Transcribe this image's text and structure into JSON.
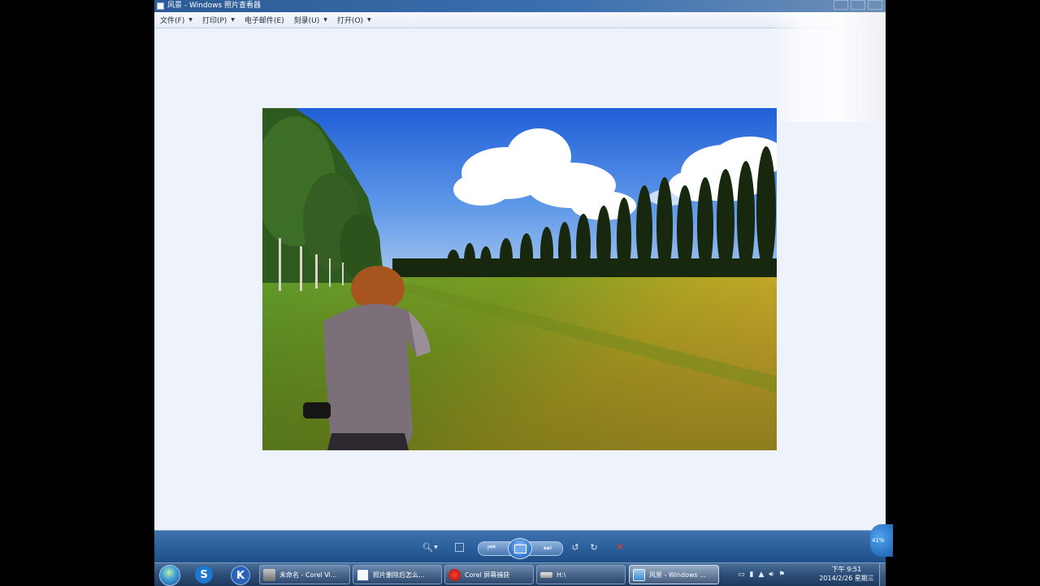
{
  "window": {
    "title": "风景 - Windows 照片查看器"
  },
  "menu": [
    {
      "label": "文件(F)",
      "has_dropdown": true
    },
    {
      "label": "打印(P)",
      "has_dropdown": true
    },
    {
      "label": "电子邮件(E)",
      "has_dropdown": false
    },
    {
      "label": "刻录(U)",
      "has_dropdown": true
    },
    {
      "label": "打开(O)",
      "has_dropdown": true
    }
  ],
  "photo": {
    "description_icon": "landscape-photo"
  },
  "viewer_toolbar": {
    "zoom_icon": "magnifier-icon",
    "actual_size_icon": "fit-window-icon",
    "prev_icon": "previous-icon",
    "slideshow_icon": "slideshow-icon",
    "next_icon": "next-icon",
    "rotate_ccw_icon": "rotate-counterclockwise-icon",
    "rotate_cw_icon": "rotate-clockwise-icon",
    "delete_icon": "delete-icon",
    "delete_color": "#e23a2e"
  },
  "zoom_badge": "41%",
  "taskbar": {
    "items": [
      {
        "label": "未命名 - Corel Vi...",
        "icon": "corel-video-icon",
        "active": false
      },
      {
        "label": "照片删除后怎么...",
        "icon": "word-document-icon",
        "active": false
      },
      {
        "label": "Corel 屏幕捕获",
        "icon": "record-icon",
        "active": false
      },
      {
        "label": "H:\\",
        "icon": "drive-icon",
        "active": false
      },
      {
        "label": "风景 - Windows ...",
        "icon": "photo-viewer-icon",
        "active": true
      }
    ],
    "clock": {
      "time": "下午 9:51",
      "date": "2014/2/26 星期三"
    }
  }
}
